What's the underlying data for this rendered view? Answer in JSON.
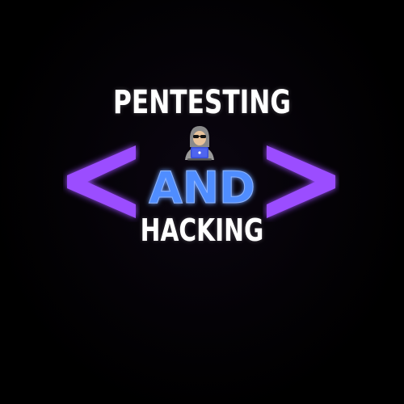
{
  "logo": {
    "title_top": "PENTESTING",
    "center_word": "AND",
    "title_bottom": "HACKING",
    "icons": [
      "hacker-icon",
      "less-than-bracket-icon",
      "greater-than-bracket-icon"
    ],
    "colors": {
      "background": "#000000",
      "text": "#ffffff",
      "bracket": "#9b4dff",
      "center_word": "#4f8dff"
    }
  }
}
